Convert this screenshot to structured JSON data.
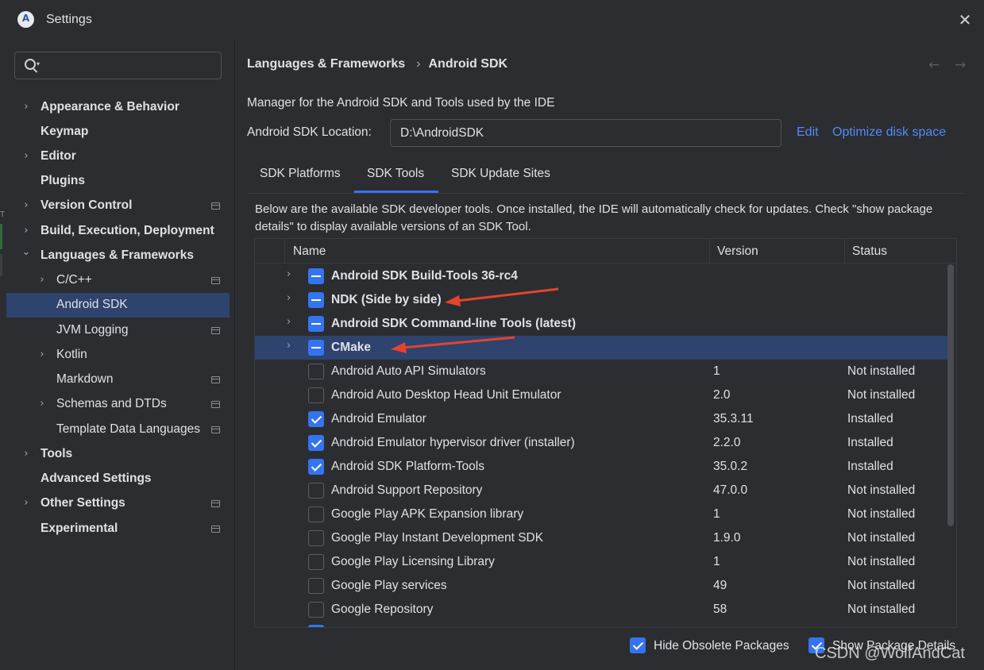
{
  "window": {
    "title": "Settings",
    "logo_letter": "A",
    "close_glyph": "✕"
  },
  "search": {
    "placeholder": "",
    "value": ""
  },
  "left_edge_letter": "T",
  "sidebar": {
    "items": [
      {
        "label": "Appearance & Behavior",
        "level": 0,
        "expandable": true,
        "expanded": false,
        "bold": true,
        "project": false
      },
      {
        "label": "Keymap",
        "level": 0,
        "expandable": false,
        "bold": true,
        "project": false
      },
      {
        "label": "Editor",
        "level": 0,
        "expandable": true,
        "expanded": false,
        "bold": true,
        "project": false
      },
      {
        "label": "Plugins",
        "level": 0,
        "expandable": false,
        "bold": true,
        "project": false
      },
      {
        "label": "Version Control",
        "level": 0,
        "expandable": true,
        "expanded": false,
        "bold": true,
        "project": true
      },
      {
        "label": "Build, Execution, Deployment",
        "level": 0,
        "expandable": true,
        "expanded": false,
        "bold": true,
        "project": false
      },
      {
        "label": "Languages & Frameworks",
        "level": 0,
        "expandable": true,
        "expanded": true,
        "bold": true,
        "project": false
      },
      {
        "label": "C/C++",
        "level": 1,
        "expandable": true,
        "expanded": false,
        "bold": false,
        "project": true
      },
      {
        "label": "Android SDK",
        "level": 1,
        "expandable": false,
        "bold": false,
        "project": false,
        "selected": true
      },
      {
        "label": "JVM Logging",
        "level": 1,
        "expandable": false,
        "bold": false,
        "project": true
      },
      {
        "label": "Kotlin",
        "level": 1,
        "expandable": true,
        "expanded": false,
        "bold": false,
        "project": false
      },
      {
        "label": "Markdown",
        "level": 1,
        "expandable": false,
        "bold": false,
        "project": true
      },
      {
        "label": "Schemas and DTDs",
        "level": 1,
        "expandable": true,
        "expanded": false,
        "bold": false,
        "project": true
      },
      {
        "label": "Template Data Languages",
        "level": 1,
        "expandable": false,
        "bold": false,
        "project": true
      },
      {
        "label": "Tools",
        "level": 0,
        "expandable": true,
        "expanded": false,
        "bold": true,
        "project": false
      },
      {
        "label": "Advanced Settings",
        "level": 0,
        "expandable": false,
        "bold": true,
        "project": false
      },
      {
        "label": "Other Settings",
        "level": 0,
        "expandable": true,
        "expanded": false,
        "bold": true,
        "project": true
      },
      {
        "label": "Experimental",
        "level": 0,
        "expandable": false,
        "bold": true,
        "project": true
      }
    ]
  },
  "breadcrumb": {
    "parent": "Languages & Frameworks",
    "separator": "›",
    "current": "Android SDK"
  },
  "nav": {
    "back": "←",
    "forward": "→"
  },
  "description": "Manager for the Android SDK and Tools used by the IDE",
  "sdk_location": {
    "label": "Android SDK Location:",
    "value": "D:\\AndroidSDK",
    "edit_link": "Edit",
    "optimize_link": "Optimize disk space"
  },
  "tabs": [
    {
      "label": "SDK Platforms",
      "active": false
    },
    {
      "label": "SDK Tools",
      "active": true
    },
    {
      "label": "SDK Update Sites",
      "active": false
    }
  ],
  "info_text": "Below are the available SDK developer tools. Once installed, the IDE will automatically check for updates. Check \"show package details\" to display available versions of an SDK Tool.",
  "table": {
    "columns": [
      "Name",
      "Version",
      "Status"
    ],
    "rows": [
      {
        "name": "Android SDK Build-Tools 36-rc4",
        "version": "",
        "status": "",
        "check": "mixed",
        "expandable": true,
        "bold": true,
        "selected": false
      },
      {
        "name": "NDK (Side by side)",
        "version": "",
        "status": "",
        "check": "mixed",
        "expandable": true,
        "bold": true,
        "selected": false
      },
      {
        "name": "Android SDK Command-line Tools (latest)",
        "version": "",
        "status": "",
        "check": "mixed",
        "expandable": true,
        "bold": true,
        "selected": false
      },
      {
        "name": "CMake",
        "version": "",
        "status": "",
        "check": "mixed",
        "expandable": true,
        "bold": true,
        "selected": true
      },
      {
        "name": "Android Auto API Simulators",
        "version": "1",
        "status": "Not installed",
        "check": "off",
        "expandable": false,
        "bold": false,
        "selected": false
      },
      {
        "name": "Android Auto Desktop Head Unit Emulator",
        "version": "2.0",
        "status": "Not installed",
        "check": "off",
        "expandable": false,
        "bold": false,
        "selected": false
      },
      {
        "name": "Android Emulator",
        "version": "35.3.11",
        "status": "Installed",
        "check": "on",
        "expandable": false,
        "bold": false,
        "selected": false
      },
      {
        "name": "Android Emulator hypervisor driver (installer)",
        "version": "2.2.0",
        "status": "Installed",
        "check": "on",
        "expandable": false,
        "bold": false,
        "selected": false
      },
      {
        "name": "Android SDK Platform-Tools",
        "version": "35.0.2",
        "status": "Installed",
        "check": "on",
        "expandable": false,
        "bold": false,
        "selected": false
      },
      {
        "name": "Android Support Repository",
        "version": "47.0.0",
        "status": "Not installed",
        "check": "off",
        "expandable": false,
        "bold": false,
        "selected": false
      },
      {
        "name": "Google Play APK Expansion library",
        "version": "1",
        "status": "Not installed",
        "check": "off",
        "expandable": false,
        "bold": false,
        "selected": false
      },
      {
        "name": "Google Play Instant Development SDK",
        "version": "1.9.0",
        "status": "Not installed",
        "check": "off",
        "expandable": false,
        "bold": false,
        "selected": false
      },
      {
        "name": "Google Play Licensing Library",
        "version": "1",
        "status": "Not installed",
        "check": "off",
        "expandable": false,
        "bold": false,
        "selected": false
      },
      {
        "name": "Google Play services",
        "version": "49",
        "status": "Not installed",
        "check": "off",
        "expandable": false,
        "bold": false,
        "selected": false
      },
      {
        "name": "Google Repository",
        "version": "58",
        "status": "Not installed",
        "check": "off",
        "expandable": false,
        "bold": false,
        "selected": false
      }
    ]
  },
  "options": {
    "hide_obsolete": {
      "label": "Hide Obsolete Packages",
      "checked": true
    },
    "show_details": {
      "label": "Show Package Details",
      "checked": true
    }
  },
  "watermark": "CSDN @WolfAndCat",
  "colors": {
    "accent": "#3574f0",
    "link": "#548af7",
    "selection": "#2e436e",
    "annotation_arrow": "#e5432f"
  }
}
